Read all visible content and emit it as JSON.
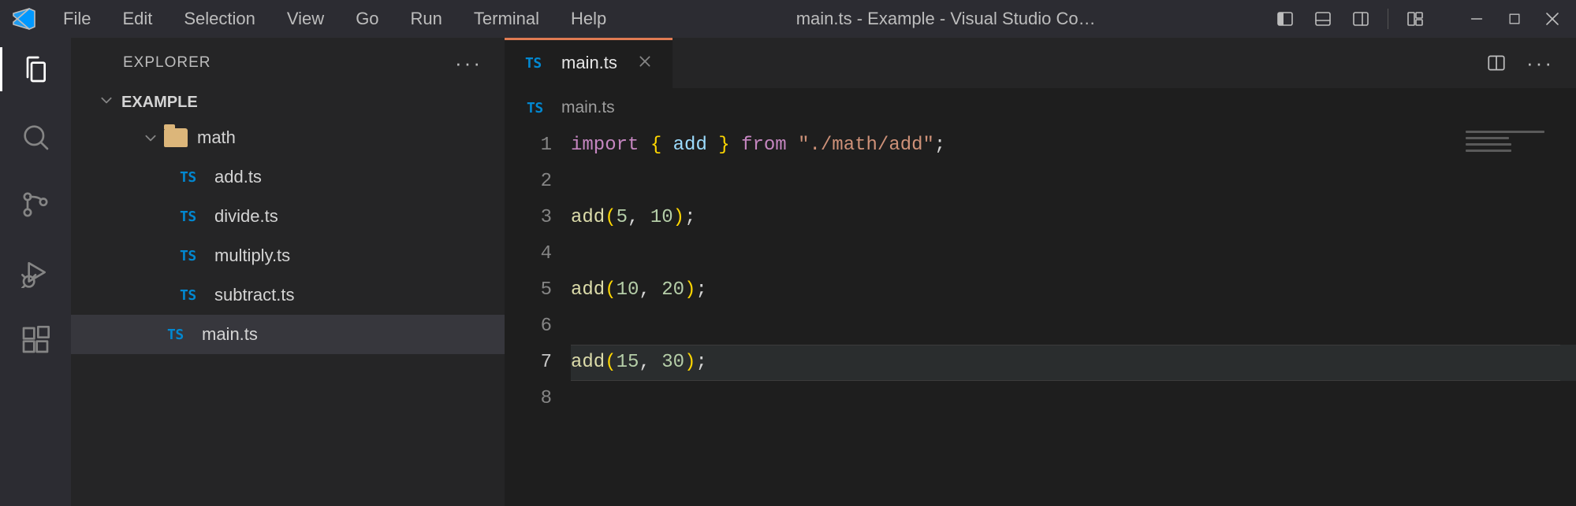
{
  "window": {
    "title": "main.ts - Example - Visual Studio Co…"
  },
  "menus": [
    "File",
    "Edit",
    "Selection",
    "View",
    "Go",
    "Run",
    "Terminal",
    "Help"
  ],
  "explorer": {
    "title": "EXPLORER",
    "rootName": "EXAMPLE",
    "folder": {
      "name": "math"
    },
    "files": {
      "f0": "add.ts",
      "f1": "divide.ts",
      "f2": "multiply.ts",
      "f3": "subtract.ts",
      "f4": "main.ts"
    }
  },
  "tabs": {
    "active": {
      "label": "main.ts"
    }
  },
  "breadcrumb": {
    "file": "main.ts"
  },
  "editor": {
    "lineNumbers": {
      "l1": "1",
      "l2": "2",
      "l3": "3",
      "l4": "4",
      "l5": "5",
      "l6": "6",
      "l7": "7",
      "l8": "8"
    },
    "code": {
      "l1": {
        "kw": "import",
        "id": "add",
        "from": "from",
        "str": "\"./math/add\""
      },
      "l3": {
        "fn": "add",
        "a": "5",
        "b": "10"
      },
      "l5": {
        "fn": "add",
        "a": "10",
        "b": "20"
      },
      "l7": {
        "fn": "add",
        "a": "15",
        "b": "30"
      }
    },
    "activeLine": 7
  },
  "icons": {
    "ts": "TS"
  }
}
